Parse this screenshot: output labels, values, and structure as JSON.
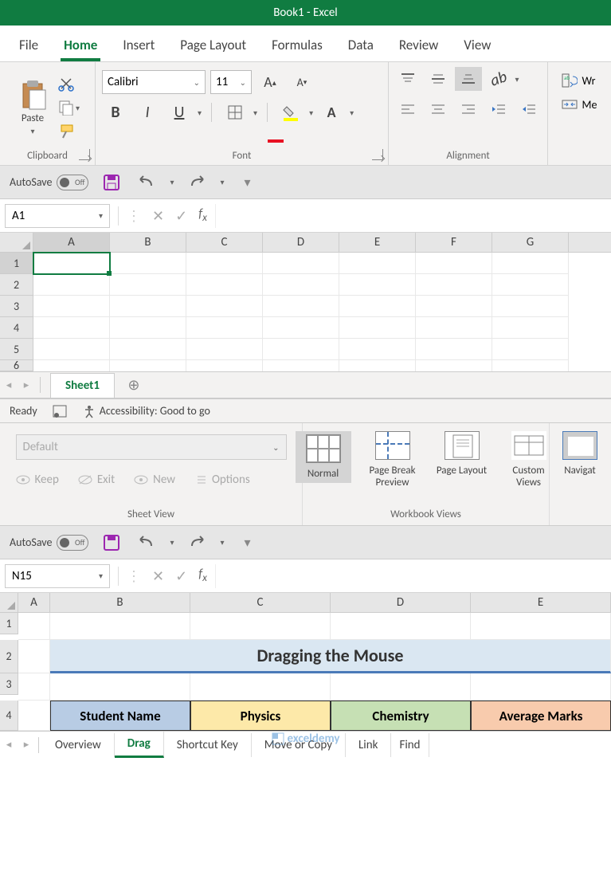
{
  "title": "Book1  -  Excel",
  "tabs": [
    "File",
    "Home",
    "Insert",
    "Page Layout",
    "Formulas",
    "Data",
    "Review",
    "View"
  ],
  "active_tab": "Home",
  "clipboard": {
    "paste": "Paste",
    "label": "Clipboard"
  },
  "font": {
    "name": "Calibri",
    "size": "11",
    "label": "Font",
    "bold": "B",
    "italic": "I",
    "underline": "U"
  },
  "alignment": {
    "label": "Alignment",
    "wrap": "Wr",
    "merge": "Me"
  },
  "qat": {
    "autosave": "AutoSave",
    "off": "Off"
  },
  "namebox1": "A1",
  "cols1": [
    "A",
    "B",
    "C",
    "D",
    "E",
    "F",
    "G"
  ],
  "rows1": [
    "1",
    "2",
    "3",
    "4",
    "5",
    "6"
  ],
  "sheet1": "Sheet1",
  "status": {
    "ready": "Ready",
    "acc": "Accessibility: Good to go"
  },
  "sheetview": {
    "default": "Default",
    "keep": "Keep",
    "exit": "Exit",
    "new": "New",
    "options": "Options",
    "label": "Sheet View"
  },
  "wbviews": {
    "normal": "Normal",
    "pbp": "Page Break Preview",
    "pl": "Page Layout",
    "cv": "Custom Views",
    "nav": "Navigat",
    "label": "Workbook Views"
  },
  "namebox2": "N15",
  "cols2": [
    "A",
    "B",
    "C",
    "D",
    "E"
  ],
  "rows2": [
    "1",
    "2",
    "3",
    "4"
  ],
  "title_cell": "Dragging the Mouse",
  "headers": [
    "Student Name",
    "Physics",
    "Chemistry",
    "Average Marks"
  ],
  "tabs2": [
    "Overview",
    "Drag",
    "Shortcut Key",
    "Move or Copy",
    "Link",
    "Find"
  ],
  "active_tab2": "Drag",
  "watermark": "exceldemy"
}
